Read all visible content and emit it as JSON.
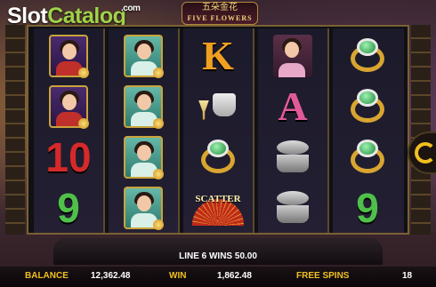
{
  "branding": {
    "logo_slot": "Slot",
    "logo_catalog": "Catalog",
    "logo_suffix": ".com"
  },
  "game": {
    "title_cn": "五朵金花",
    "title_en": "FIVE FLOWERS"
  },
  "reels": [
    [
      "lady-red-icon",
      "lady-red-icon",
      "ten-icon",
      "nine-icon"
    ],
    [
      "lady-green-icon",
      "lady-green-icon",
      "lady-green-icon",
      "lady-green-icon"
    ],
    [
      "king-icon",
      "champagne-icon",
      "ring-icon",
      "scatter-icon"
    ],
    [
      "lady-pink-icon",
      "ace-icon",
      "jewelry-box-icon",
      "jewelry-box-icon"
    ],
    [
      "ring-icon",
      "ring-icon",
      "ring-icon",
      "nine-icon"
    ]
  ],
  "symbols": {
    "ten": "10",
    "nine": "9",
    "king": "K",
    "ace": "A",
    "scatter": "SCATTER"
  },
  "status": {
    "line_win": "LINE 6 WINS 50.00"
  },
  "footer": {
    "balance_label": "BALANCE",
    "balance_value": "12,362.48",
    "win_label": "WIN",
    "win_value": "1,862.48",
    "free_spins_label": "FREE SPINS",
    "free_spins_value": "18"
  },
  "colors": {
    "accent": "#f0c020",
    "frame_gold": "#7a6232"
  }
}
